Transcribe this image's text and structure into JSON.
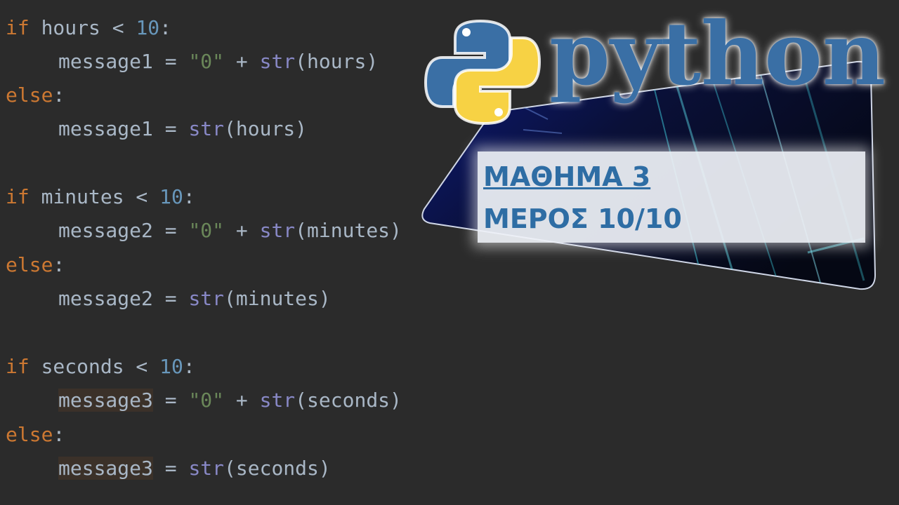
{
  "code": {
    "lines": [
      [
        {
          "t": "if",
          "c": "keyword"
        },
        {
          "t": " hours < ",
          "c": ""
        },
        {
          "t": "10",
          "c": "number"
        },
        {
          "t": ":",
          "c": ""
        }
      ],
      [
        {
          "t": "message1",
          "c": ""
        },
        {
          "t": " = ",
          "c": ""
        },
        {
          "t": "\"0\"",
          "c": "string"
        },
        {
          "t": " + ",
          "c": ""
        },
        {
          "t": "str",
          "c": "builtin"
        },
        {
          "t": "(hours)",
          "c": ""
        }
      ],
      [
        {
          "t": "else",
          "c": "keyword"
        },
        {
          "t": ":",
          "c": ""
        }
      ],
      [
        {
          "t": "message1",
          "c": ""
        },
        {
          "t": " = ",
          "c": ""
        },
        {
          "t": "str",
          "c": "builtin"
        },
        {
          "t": "(hours)",
          "c": ""
        }
      ],
      [
        {
          "t": "if",
          "c": "keyword"
        },
        {
          "t": " minutes < ",
          "c": ""
        },
        {
          "t": "10",
          "c": "number"
        },
        {
          "t": ":",
          "c": ""
        }
      ],
      [
        {
          "t": "message2",
          "c": ""
        },
        {
          "t": " = ",
          "c": ""
        },
        {
          "t": "\"0\"",
          "c": "string"
        },
        {
          "t": " + ",
          "c": ""
        },
        {
          "t": "str",
          "c": "builtin"
        },
        {
          "t": "(minutes)",
          "c": ""
        }
      ],
      [
        {
          "t": "else",
          "c": "keyword"
        },
        {
          "t": ":",
          "c": ""
        }
      ],
      [
        {
          "t": "message2",
          "c": ""
        },
        {
          "t": " = ",
          "c": ""
        },
        {
          "t": "str",
          "c": "builtin"
        },
        {
          "t": "(minutes)",
          "c": ""
        }
      ],
      [
        {
          "t": "if",
          "c": "keyword"
        },
        {
          "t": " seconds < ",
          "c": ""
        },
        {
          "t": "10",
          "c": "number"
        },
        {
          "t": ":",
          "c": ""
        }
      ],
      [
        {
          "t": "message3",
          "c": "hl"
        },
        {
          "t": " = ",
          "c": ""
        },
        {
          "t": "\"0\"",
          "c": "string"
        },
        {
          "t": " + ",
          "c": ""
        },
        {
          "t": "str",
          "c": "builtin"
        },
        {
          "t": "(seconds)",
          "c": ""
        }
      ],
      [
        {
          "t": "else",
          "c": "keyword"
        },
        {
          "t": ":",
          "c": ""
        }
      ],
      [
        {
          "t": "message3",
          "c": "hl"
        },
        {
          "t": " = ",
          "c": ""
        },
        {
          "t": "str",
          "c": "builtin"
        },
        {
          "t": "(seconds)",
          "c": ""
        }
      ]
    ],
    "indented": [
      false,
      true,
      false,
      true,
      false,
      true,
      false,
      true,
      false,
      true,
      false,
      true
    ]
  },
  "banner": {
    "logo_word": "python",
    "lesson_title": "ΜΑΘΗΜΑ 3",
    "lesson_part": "ΜΕΡΟΣ 10/10"
  },
  "colors": {
    "background": "#2b2b2b",
    "keyword": "#cc7832",
    "number": "#6897bb",
    "string": "#6a8759",
    "builtin": "#8888c6",
    "text": "#a9b7c6",
    "python_blue": "#3a6fa5",
    "python_yellow": "#f7d244"
  },
  "icons": [
    "python-logo-icon"
  ]
}
